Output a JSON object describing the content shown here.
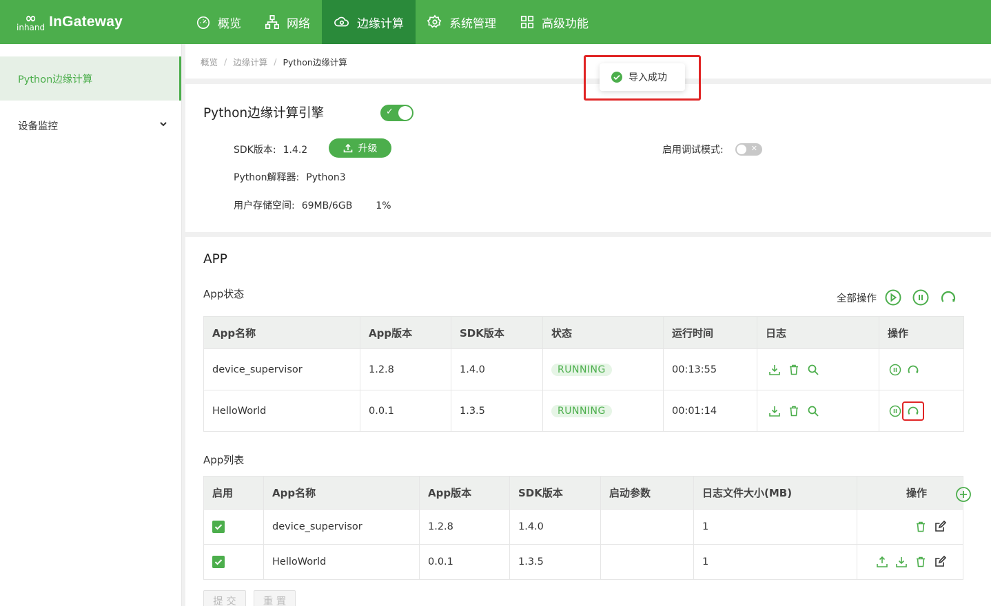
{
  "header": {
    "logo_small": "inhand",
    "logo_text": "InGateway",
    "nav": [
      {
        "label": "概览",
        "icon": "dashboard-icon",
        "active": false
      },
      {
        "label": "网络",
        "icon": "network-icon",
        "active": false
      },
      {
        "label": "边缘计算",
        "icon": "cloud-compute-icon",
        "active": true
      },
      {
        "label": "系统管理",
        "icon": "gear-icon",
        "active": false
      },
      {
        "label": "高级功能",
        "icon": "grid-icon",
        "active": false
      }
    ]
  },
  "sidebar": {
    "items": [
      {
        "label": "Python边缘计算",
        "active": true
      },
      {
        "label": "设备监控",
        "active": false
      }
    ]
  },
  "breadcrumb": [
    "概览",
    "边缘计算",
    "Python边缘计算"
  ],
  "toast": {
    "message": "导入成功"
  },
  "engine": {
    "title": "Python边缘计算引擎",
    "enabled": true,
    "sdk_label": "SDK版本:",
    "sdk_value": "1.4.2",
    "upgrade_label": "升级",
    "interpreter_label": "Python解释器:",
    "interpreter_value": "Python3",
    "storage_label": "用户存储空间:",
    "storage_value": "69MB/6GB",
    "storage_percent": "1%",
    "debug_label": "启用调试模式:",
    "debug_enabled": false
  },
  "app": {
    "title": "APP",
    "status_title": "App状态",
    "all_ops_label": "全部操作",
    "status_table": {
      "headers": [
        "App名称",
        "App版本",
        "SDK版本",
        "状态",
        "运行时间",
        "日志",
        "操作"
      ],
      "rows": [
        {
          "name": "device_supervisor",
          "app_version": "1.2.8",
          "sdk_version": "1.4.0",
          "status": "RUNNING",
          "runtime": "00:13:55"
        },
        {
          "name": "HelloWorld",
          "app_version": "0.0.1",
          "sdk_version": "1.3.5",
          "status": "RUNNING",
          "runtime": "00:01:14"
        }
      ]
    },
    "list_title": "App列表",
    "list_table": {
      "headers": [
        "启用",
        "App名称",
        "App版本",
        "SDK版本",
        "启动参数",
        "日志文件大小(MB)",
        "操作"
      ],
      "rows": [
        {
          "enabled": true,
          "name": "device_supervisor",
          "app_version": "1.2.8",
          "sdk_version": "1.4.0",
          "params": "",
          "log_size": "1"
        },
        {
          "enabled": true,
          "name": "HelloWorld",
          "app_version": "0.0.1",
          "sdk_version": "1.3.5",
          "params": "",
          "log_size": "1"
        }
      ]
    },
    "submit_label": "提 交",
    "reset_label": "重 置"
  },
  "colors": {
    "brand": "#4cae4c",
    "brand_dark": "#2a8a3a",
    "highlight": "#e02424"
  }
}
